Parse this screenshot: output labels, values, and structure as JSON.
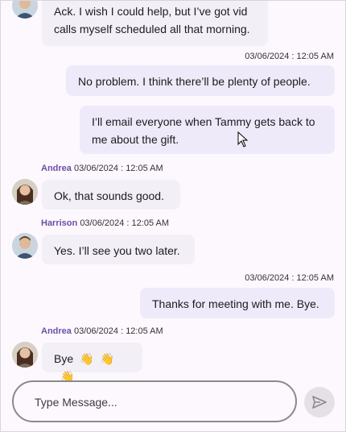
{
  "messages": [
    {
      "id": "m1",
      "direction": "in",
      "text": "Ack. I wish I could help, but I’ve got vid calls myself scheduled all that morning."
    },
    {
      "id": "m2",
      "direction": "out",
      "timestamp": "03/06/2024 : 12:05 AM",
      "text": "No problem. I think there’ll be plenty of people."
    },
    {
      "id": "m3",
      "direction": "out",
      "text": "I’ll email everyone when Tammy gets back to me about the gift."
    },
    {
      "id": "m4",
      "direction": "in",
      "author": "Andrea",
      "timestamp": "03/06/2024 : 12:05 AM",
      "text": "Ok, that sounds good."
    },
    {
      "id": "m5",
      "direction": "in",
      "author": "Harrison",
      "timestamp": "03/06/2024 : 12:05 AM",
      "text": "Yes. I’ll see you two later."
    },
    {
      "id": "m6",
      "direction": "out",
      "timestamp": "03/06/2024 : 12:05 AM",
      "text": "Thanks for meeting with me. Bye."
    },
    {
      "id": "m7",
      "direction": "in",
      "author": "Andrea",
      "timestamp": "03/06/2024 : 12:05 AM",
      "text": "Bye",
      "emoji": "👋"
    }
  ],
  "composer": {
    "placeholder": "Type Message...",
    "send_icon": "send-icon"
  },
  "colors": {
    "author_name": "#6b4fa8",
    "incoming_bubble": "#f3eff6",
    "outgoing_bubble": "#efeafa",
    "background": "#fdf8fd"
  }
}
